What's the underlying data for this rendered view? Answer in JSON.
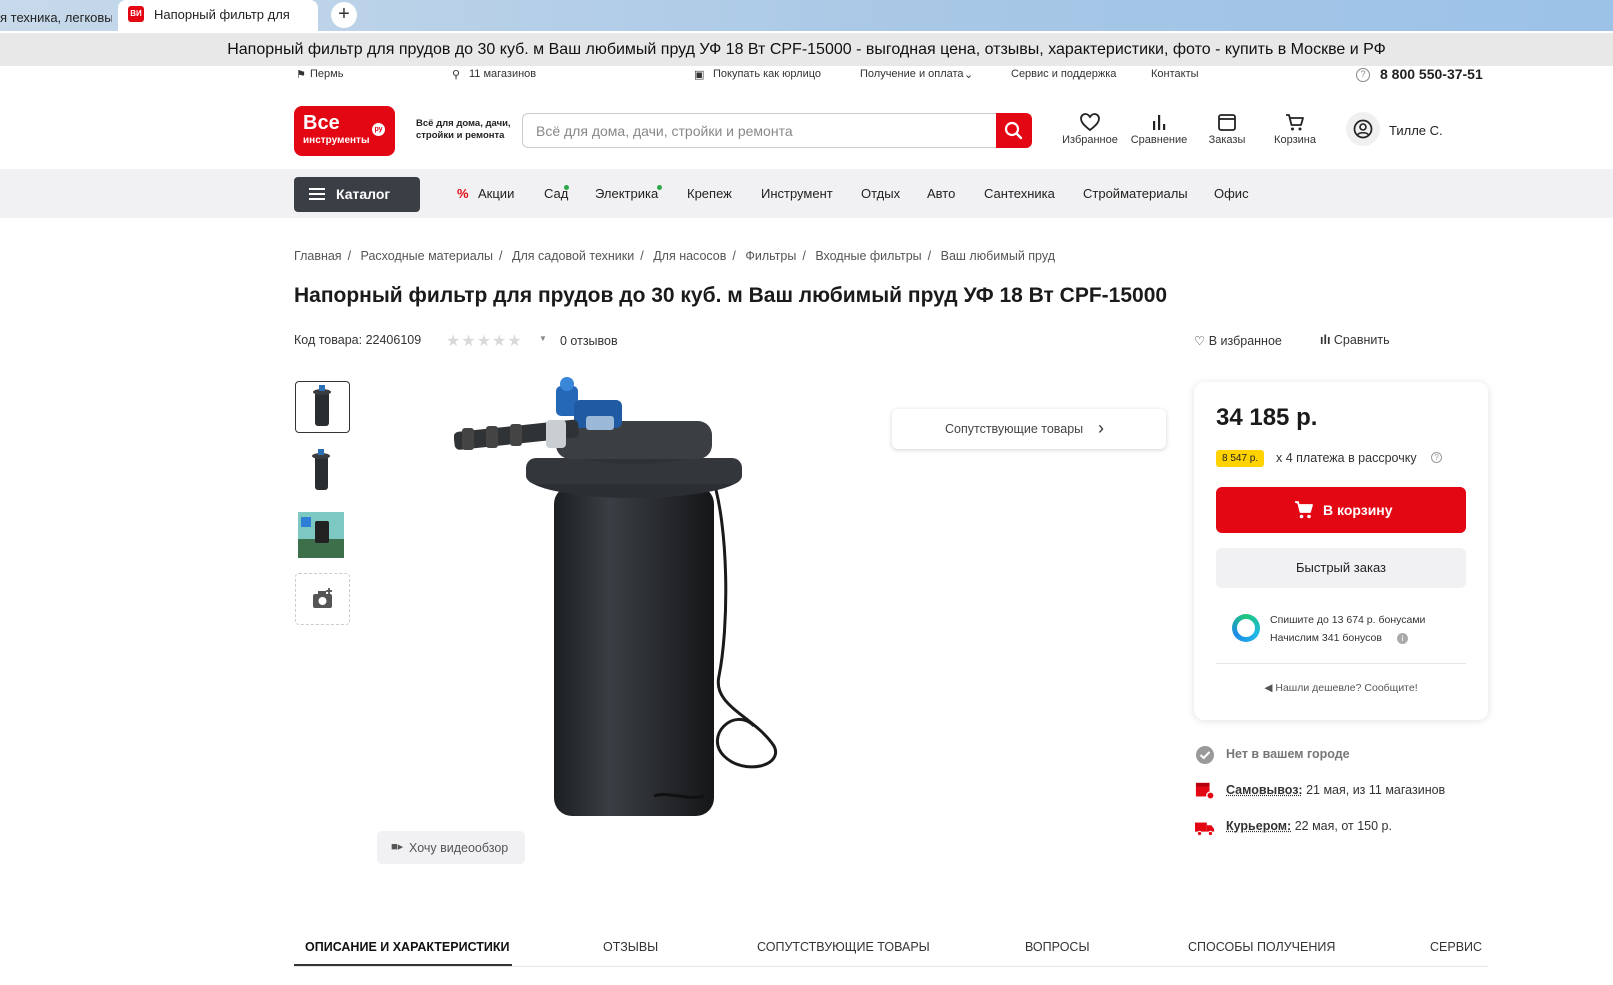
{
  "browser": {
    "inactive_tab": "я техника, легковы",
    "active_tab": "Напорный фильтр для",
    "tab_close": "✕",
    "new_tab": "+",
    "favicon_text": "ВИ",
    "window_title": "Напорный фильтр для прудов до 30 куб. м Ваш любимый пруд УФ 18 Вт CPF-15000 - выгодная цена, отзывы, характеристики, фото - купить в Москве и РФ"
  },
  "infobar": {
    "city": "Пермь",
    "stores": "11 магазинов",
    "legal": "Покупать как юрлицо",
    "delivery": "Получение и оплата",
    "service": "Сервис и поддержка",
    "contacts": "Контакты",
    "phone": "8 800 550-37-51"
  },
  "header": {
    "logo_line1": "Все",
    "logo_line2": "инструменты",
    "logo_badge": "ру",
    "slogan": "Всё для дома, дачи, стройки и ремонта",
    "search_placeholder": "Всё для дома, дачи, стройки и ремонта",
    "icons": {
      "favorites": "Избранное",
      "compare": "Сравнение",
      "orders": "Заказы",
      "cart": "Корзина"
    },
    "user_name": "Тилле С."
  },
  "nav": {
    "catalog": "Каталог",
    "items": [
      "Акции",
      "Сад",
      "Электрика",
      "Крепеж",
      "Инструмент",
      "Отдых",
      "Авто",
      "Сантехника",
      "Стройматериалы",
      "Офис"
    ]
  },
  "breadcrumbs": [
    "Главная",
    "Расходные материалы",
    "Для садовой техники",
    "Для насосов",
    "Фильтры",
    "Входные фильтры",
    "Ваш любимый пруд"
  ],
  "product": {
    "title": "Напорный фильтр для прудов до 30 куб. м Ваш любимый пруд УФ 18 Вт CPF-15000",
    "code_label": "Код товара: 22406109",
    "stars": "★★★★★",
    "rating": 0,
    "reviews": "0 отзывов",
    "add_favorite": "В избранное",
    "compare": "Сравнить",
    "video_review": "Хочу видеообзор",
    "related": "Сопутствующие товары"
  },
  "buy": {
    "price": "34 185 р.",
    "installment_amount": "8 547 р.",
    "installment_text": "х 4 платежа в рассрочку",
    "cart_button": "В корзину",
    "quick_order": "Быстрый заказ",
    "bonus_line1": "Спишите до 13 674 р. бонусами",
    "bonus_line2": "Начислим 341 бонусов",
    "cheaper": "Нашли дешевле? Сообщите!"
  },
  "delivery": {
    "not_in_city": "Нет в вашем городе",
    "pickup_label": "Самовывоз:",
    "pickup_value": "21 мая, из 11 магазинов",
    "courier_label": "Курьером:",
    "courier_value": "22 мая, от 150 р."
  },
  "tabs": [
    "ОПИСАНИЕ И ХАРАКТЕРИСТИКИ",
    "ОТЗЫВЫ",
    "СОПУТСТВУЮЩИЕ ТОВАРЫ",
    "ВОПРОСЫ",
    "СПОСОБЫ ПОЛУЧЕНИЯ",
    "СЕРВИС"
  ],
  "colors": {
    "brand_red": "#e30613",
    "nav_bg": "#f1f1f3",
    "catalog_btn": "#3a3f46",
    "installment_yellow": "#ffd200",
    "green_dot": "#2ca84a"
  }
}
